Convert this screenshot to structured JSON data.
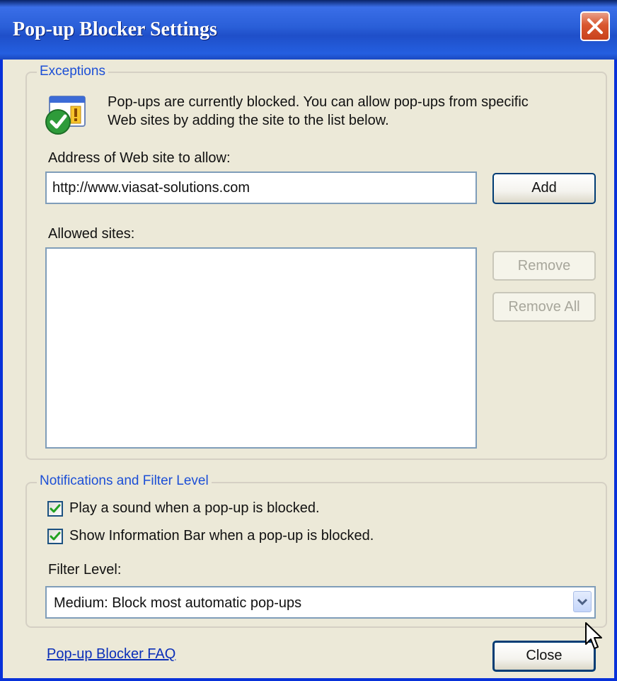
{
  "window": {
    "title": "Pop-up Blocker Settings"
  },
  "exceptions": {
    "legend": "Exceptions",
    "info_line1": "Pop-ups are currently blocked.  You can allow pop-ups from specific",
    "info_line2": "Web sites by adding the site to the list below.",
    "address_label": "Address of Web site to allow:",
    "address_value": "http://www.viasat-solutions.com",
    "add_label": "Add",
    "allowed_label": "Allowed sites:",
    "allowed_sites": [],
    "remove_label": "Remove",
    "remove_all_label": "Remove All"
  },
  "notifications": {
    "legend": "Notifications and Filter Level",
    "play_sound_label": "Play a sound when a pop-up is blocked.",
    "play_sound_checked": true,
    "info_bar_label": "Show Information Bar when a pop-up is blocked.",
    "info_bar_checked": true,
    "filter_level_label": "Filter Level:",
    "filter_level_value": "Medium: Block most automatic pop-ups"
  },
  "footer": {
    "faq_link": "Pop-up Blocker FAQ",
    "close_label": "Close"
  },
  "icons": {
    "title_close": "close-icon",
    "info": "shield-check-warning-icon",
    "combo": "chevron-down-icon",
    "cursor": "mouse-cursor-icon"
  },
  "colors": {
    "titlebar": "#245fe0",
    "close_button": "#d9572f",
    "legend_text": "#1c4fd6",
    "link": "#0b2fb8",
    "checkmark": "#21a121"
  }
}
